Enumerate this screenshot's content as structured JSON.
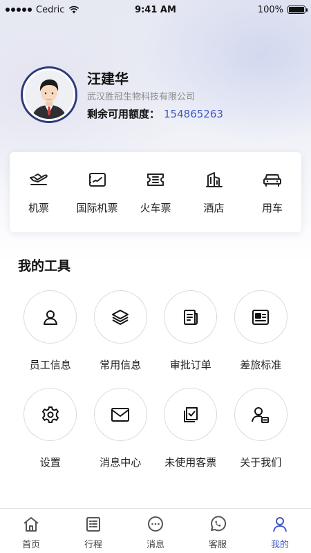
{
  "status_bar": {
    "carrier": "Cedric",
    "time": "9:41 AM",
    "battery": "100%"
  },
  "profile": {
    "name": "汪建华",
    "company": "武汉胜冠生物科技有限公司",
    "credit_label": "剩余可用额度：",
    "credit_value": "154865263"
  },
  "services": [
    {
      "label": "机票",
      "icon": "plane-icon"
    },
    {
      "label": "国际机票",
      "icon": "intl-ticket-icon"
    },
    {
      "label": "火车票",
      "icon": "train-ticket-icon"
    },
    {
      "label": "酒店",
      "icon": "hotel-icon"
    },
    {
      "label": "用车",
      "icon": "car-icon"
    }
  ],
  "tools": {
    "title": "我的工具",
    "items": [
      {
        "label": "员工信息",
        "icon": "user-icon"
      },
      {
        "label": "常用信息",
        "icon": "layers-icon"
      },
      {
        "label": "审批订单",
        "icon": "document-icon"
      },
      {
        "label": "差旅标准",
        "icon": "id-card-icon"
      },
      {
        "label": "设置",
        "icon": "gear-icon"
      },
      {
        "label": "消息中心",
        "icon": "mail-icon"
      },
      {
        "label": "未使用客票",
        "icon": "ticket-check-icon"
      },
      {
        "label": "关于我们",
        "icon": "user-badge-icon"
      }
    ]
  },
  "tab_bar": {
    "active": "我的",
    "items": [
      {
        "label": "首页",
        "icon": "home-icon"
      },
      {
        "label": "行程",
        "icon": "itinerary-icon"
      },
      {
        "label": "消息",
        "icon": "chat-icon"
      },
      {
        "label": "客服",
        "icon": "whatsapp-icon"
      },
      {
        "label": "我的",
        "icon": "profile-icon"
      }
    ]
  },
  "colors": {
    "accent": "#3f56c5",
    "avatar_ring": "#2d3a7a"
  }
}
